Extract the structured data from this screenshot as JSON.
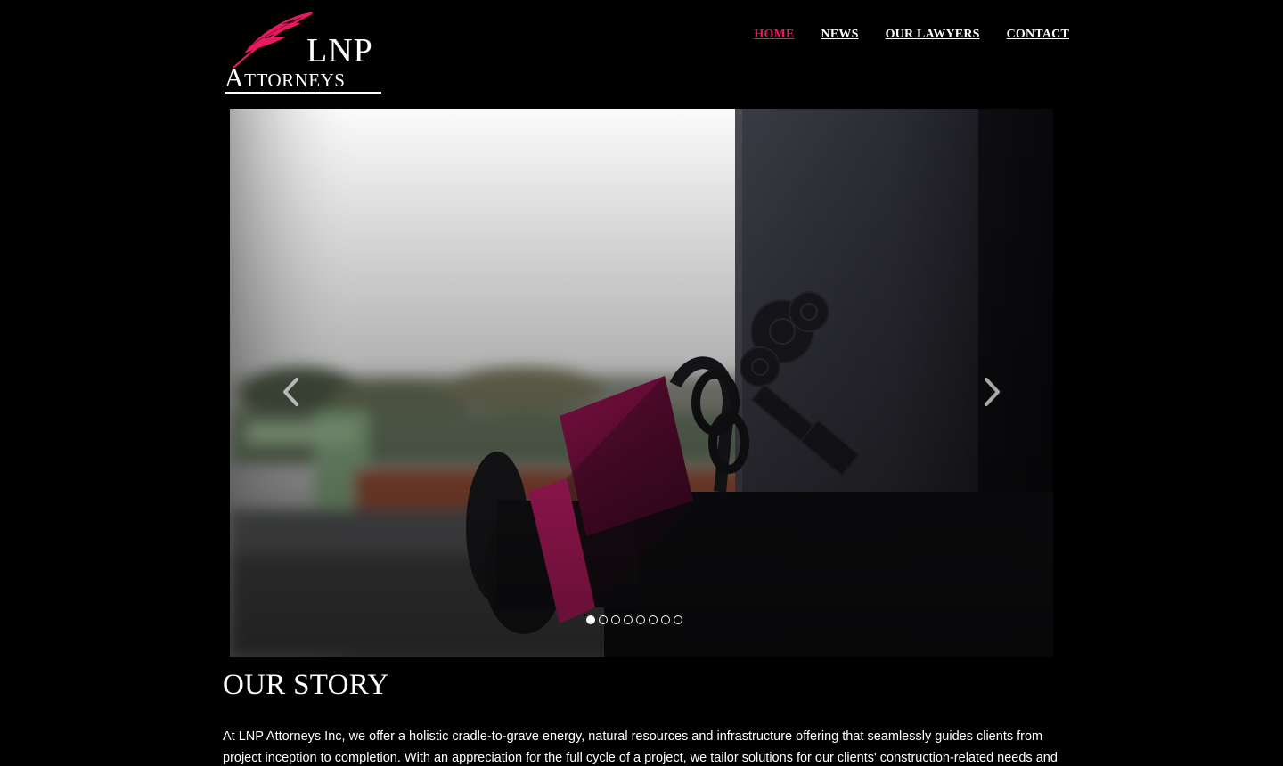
{
  "brand": {
    "line1": "LNP",
    "line2": "Attorneys",
    "accent_color": "#e8195f",
    "icon": "quill-feather-icon"
  },
  "nav": {
    "items": [
      {
        "label": "HOME",
        "active": true
      },
      {
        "label": "NEWS",
        "active": false
      },
      {
        "label": "OUR LAWYERS",
        "active": false
      },
      {
        "label": "CONTACT",
        "active": false
      }
    ]
  },
  "slider": {
    "prev_icon": "chevron-left-icon",
    "next_icon": "chevron-right-icon",
    "slide_count": 8,
    "active_slide": 1
  },
  "story": {
    "title": "OUR STORY",
    "body": "At LNP Attorneys Inc, we offer a holistic cradle-to-grave energy, natural resources and infrastructure offering that seamlessly guides clients from project inception to completion. With an appreciation for the full cycle of a project, we tailor solutions for our clients' construction-related needs and offer clients"
  }
}
